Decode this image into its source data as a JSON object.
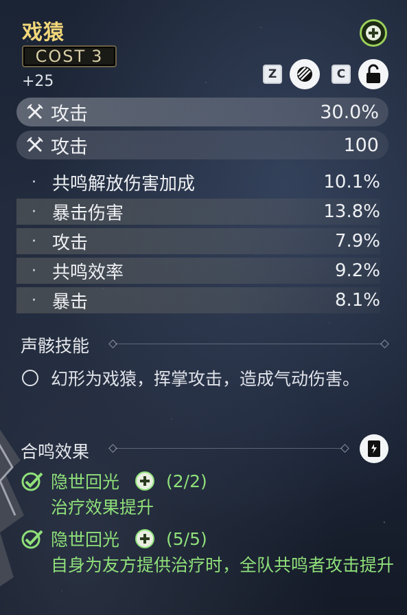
{
  "echo": {
    "name": "戏猿",
    "cost_label": "COST",
    "cost_value": "3",
    "level": "+25"
  },
  "controls": {
    "add_icon": "plus-badge-icon",
    "key_z": "Z",
    "key_c": "C",
    "discard_icon": "discard-icon",
    "lock_icon": "unlock-icon"
  },
  "main_stats": [
    {
      "icon": "sword-cross-icon",
      "label": "攻击",
      "value": "30.0%"
    },
    {
      "icon": "sword-cross-icon",
      "label": "攻击",
      "value": "100"
    }
  ],
  "sub_stats": [
    {
      "bullet": "·",
      "label": "共鸣解放伤害加成",
      "value": "10.1%"
    },
    {
      "bullet": "·",
      "label": "暴击伤害",
      "value": "13.8%"
    },
    {
      "bullet": "·",
      "label": "攻击",
      "value": "7.9%"
    },
    {
      "bullet": "·",
      "label": "共鸣效率",
      "value": "9.2%"
    },
    {
      "bullet": "·",
      "label": "暴击",
      "value": "8.1%"
    }
  ],
  "skill": {
    "heading": "声骸技能",
    "text": "幻形为戏猿，挥掌攻击，造成气动伤害。"
  },
  "sonata": {
    "heading": "合鸣效果",
    "effects": [
      {
        "name": "隐世回光",
        "progress": "(2/2)",
        "desc": "治疗效果提升"
      },
      {
        "name": "隐世回光",
        "progress": "(5/5)",
        "desc": "自身为友方提供治疗时，全队共鸣者攻击提升"
      }
    ]
  },
  "colors": {
    "title": "#f2d77a",
    "active_set": "#8fe07a"
  }
}
